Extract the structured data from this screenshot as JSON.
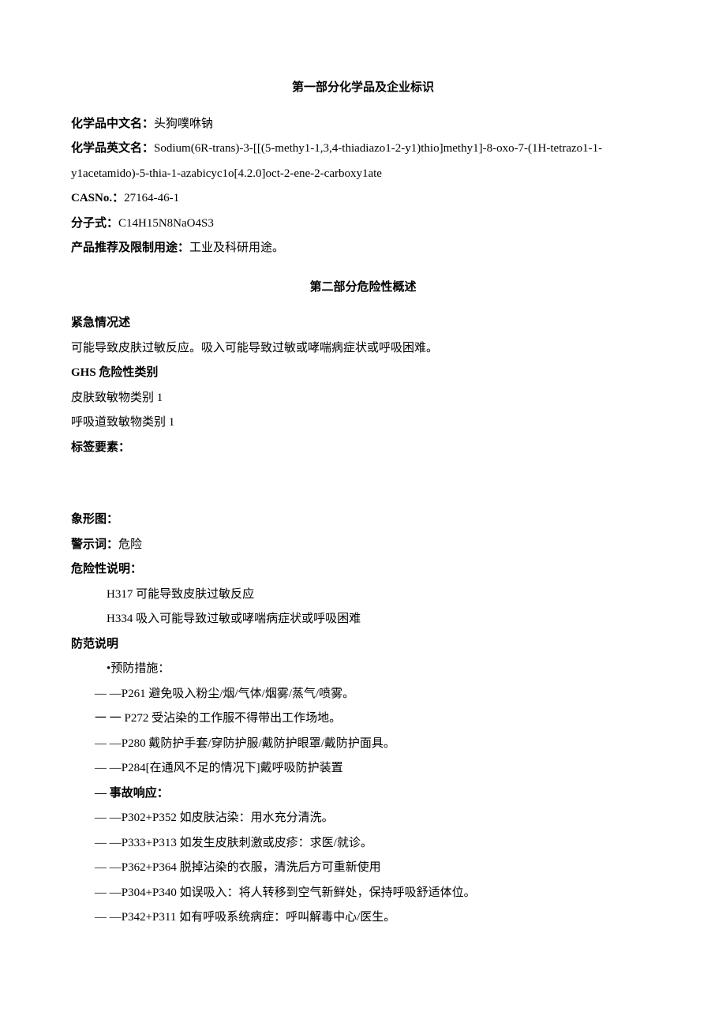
{
  "section1": {
    "title": "第一部分化学品及企业标识",
    "cnNameLabel": "化学品中文名：",
    "cnName": "头狗噗咻钠",
    "enNameLabel": "化学品英文名：",
    "enName1": "Sodium(6R-trans)-3-[[(5-methy1-1,3,4-thiadiazo1-2-y1)thio]methy1]-8-oxo-7-(1H-tetrazo1-1-",
    "enName2": "y1acetamido)-5-thia-1-azabicyc1o[4.2.0]oct-2-ene-2-carboxy1ate",
    "casLabel": "CASNo.：",
    "cas": "27164-46-1",
    "formulaLabel": "分子式：",
    "formula": "C14H15N8NaO4S3",
    "useLabel": "产品推荐及限制用途：",
    "use": "工业及科研用途。"
  },
  "section2": {
    "title": "第二部分危险性概述",
    "emergencyLabel": "紧急情况述",
    "emergencyText": "可能导致皮肤过敏反应。吸入可能导致过敏或哮喘病症状或呼吸困难。",
    "ghsLabel": "GHS 危险性类别",
    "ghs1": "皮肤致敏物类别 1",
    "ghs2": "呼吸道致敏物类别 1",
    "labelElements": "标签要素：",
    "pictogram": "象形图：",
    "signalLabel": "警示词：",
    "signal": "危险",
    "hazardLabel": "危险性说明：",
    "h317": "H317 可能导致皮肤过敏反应",
    "h334": "H334 吸入可能导致过敏或哮喘病症状或呼吸困难",
    "precautionLabel": "防范说明",
    "preventLabel": "•预防措施：",
    "p261": "—  —P261 避免吸入粉尘/烟/气体/烟雾/蒸气/喷雾。",
    "p272": "一 一 P272 受沾染的工作服不得带出工作场地。",
    "p280": "—  —P280 戴防护手套/穿防护服/戴防护眼罩/戴防护面具。",
    "p284": "—  —P284[在通风不足的情况下]戴呼吸防护装置",
    "responseLabel": "— 事故响应：",
    "p302": "—  —P302+P352 如皮肤沾染：用水充分清洗。",
    "p333": "—  —P333+P313 如发生皮肤刺激或皮疹：求医/就诊。",
    "p362": "—  —P362+P364 脱掉沾染的衣服，清洗后方可重新使用",
    "p304": "—  —P304+P340 如误吸入：将人转移到空气新鲜处，保持呼吸舒适体位。",
    "p342": "—  —P342+P311 如有呼吸系统病症：呼叫解毒中心/医生。"
  }
}
